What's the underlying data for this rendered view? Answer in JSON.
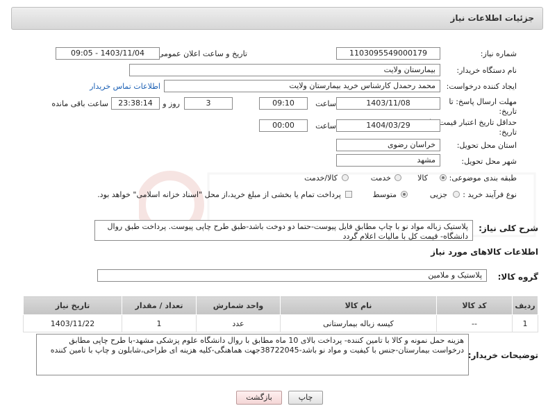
{
  "header": {
    "title": "جزئیات اطلاعات نیاز"
  },
  "fields": {
    "need_number_label": "شماره نیاز:",
    "need_number": "1103095549000179",
    "announce_label": "تاریخ و ساعت اعلان عمومی:",
    "announce_value": "1403/11/04 - 09:05",
    "buyer_org_label": "نام دستگاه خریدار:",
    "buyer_org": "بیمارستان ولایت",
    "creator_label": "ایجاد کننده درخواست:",
    "creator": "محمد رحمدل کارشناس خرید بیمارستان ولایت",
    "contact_link": "اطلاعات تماس خریدار",
    "reply_deadline_label": "مهلت ارسال پاسخ: تا تاریخ:",
    "reply_date": "1403/11/08",
    "time_label": "ساعت",
    "reply_time": "09:10",
    "days_value": "3",
    "days_label": "روز و",
    "remaining_time": "23:38:14",
    "remaining_label": "ساعت باقی مانده",
    "validity_label": "حداقل تاریخ اعتبار قیمت: تا تاریخ:",
    "validity_date": "1404/03/29",
    "validity_time": "00:00",
    "province_label": "استان محل تحویل:",
    "province": "خراسان رضوی",
    "city_label": "شهر محل تحویل:",
    "city": "مشهد",
    "category_label": "طبقه بندی موضوعی:",
    "category_options": [
      "کالا",
      "خدمت",
      "کالا/خدمت"
    ],
    "process_label": "نوع فرآیند خرید :",
    "process_options": [
      "جزیی",
      "متوسط"
    ],
    "payment_note": "پرداخت تمام یا بخشی از مبلغ خرید،از محل \"اسناد خزانه اسلامی\" خواهد بود."
  },
  "summary": {
    "label": "شرح کلی نیاز:",
    "text": "پلاستیک زباله مواد نو با چاپ مطابق فایل پیوست-حتما دو دوخت باشد-طبق طرح چاپی پیوست. پرداخت طبق روال دانشگاه- قیمت کل با مالیات اعلام گردد"
  },
  "goods_section": {
    "title": "اطلاعات کالاهای مورد نیاز",
    "group_label": "گروه کالا:",
    "group_value": "پلاستیک و ملامین"
  },
  "table": {
    "headers": [
      "ردیف",
      "کد کالا",
      "نام کالا",
      "واحد شمارش",
      "تعداد / مقدار",
      "تاریخ نیاز"
    ],
    "rows": [
      [
        "1",
        "--",
        "کیسه زباله بیمارستانی",
        "عدد",
        "1",
        "1403/11/22"
      ]
    ]
  },
  "buyer_notes": {
    "label": "توضیحات خریدار:",
    "text": "هزینه حمل نمونه و کالا با تامین کننده- پرداخت بالای 10 ماه مطابق با روال دانشگاه علوم پزشکی مشهد-با طرح چاپی مطابق درخواست بیمارستان-جنس با کیفیت و مواد نو باشد-38722045جهت هماهنگی-کلیه هزینه ای طراحی،شابلون و چاپ با تامین کننده"
  },
  "buttons": {
    "print": "چاپ",
    "back": "بازگشت"
  }
}
